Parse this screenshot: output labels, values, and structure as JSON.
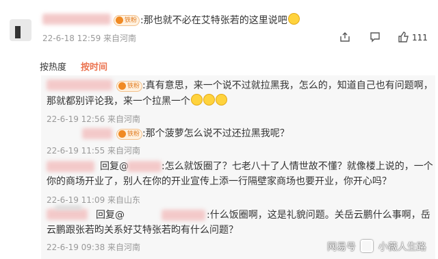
{
  "top_comment": {
    "text": ":那也就不必在艾特张若的这里说吧",
    "badge": "铁粉",
    "time": "22-6-18 12:59 来自河南",
    "like_count": "111"
  },
  "sort": {
    "hot": "按热度",
    "time": "按时间"
  },
  "replies": [
    {
      "badge": "铁粉",
      "line1": ":真有意思，来一个说不过就拉黑我，怎么的，知道自己也有问题啊，",
      "line2": "那就都别评论我，来一个拉黑一个",
      "time": "22-6-19 12:56 来自河南"
    },
    {
      "badge": "铁粉",
      "line1": ":那个菠萝怎么说不过还拉黑我呢？",
      "time": "22-6-19 11:55 来自河南"
    },
    {
      "reply_prefix": "回复@",
      "line1": ":怎么就饭圈了？七老八十了人情世故不懂？就像楼上说的，一个",
      "line2": "你的商场开业了，别人在你的开业宣传上添一行隔壁家商场也要开业，你开心吗？",
      "time": "22-6-19 11:09 来自山东"
    },
    {
      "reply_prefix": "回复@",
      "line1": ":什么饭圈啊，这是礼貌问题。关岳云鹏什么事啊，岳",
      "line2": "云鹏跟张若昀关系好艾特张若昀有什么问题？",
      "time": "22-6-19 09:38 来自河南"
    }
  ],
  "watermark": {
    "site": "网易号",
    "author": "小薇人生路"
  },
  "icons": [
    "share-icon",
    "comment-icon",
    "like-icon",
    "avatar",
    "emoji-grin-icon"
  ]
}
